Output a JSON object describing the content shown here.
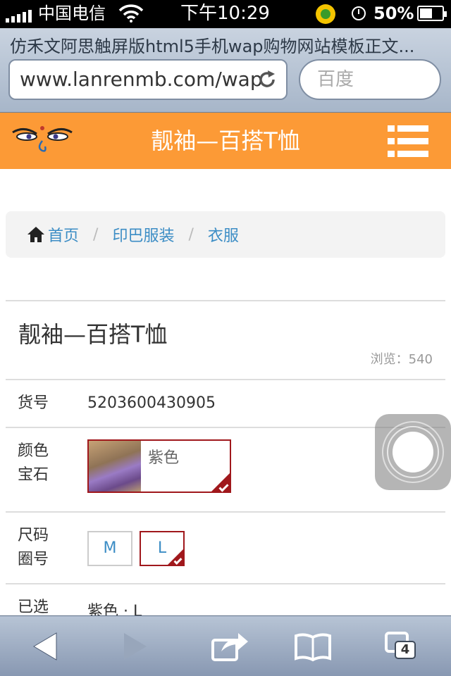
{
  "status_bar": {
    "carrier": "中国电信",
    "time": "下午10:29",
    "battery": "50%",
    "battery_level": 0.5
  },
  "browser": {
    "page_title": "仿禾文阿思触屏版html5手机wap购物网站模板正文...",
    "url": "www.lanrenmb.com/wap",
    "search_placeholder": "百度",
    "tab_count": "4"
  },
  "header": {
    "title": "靓袖—百搭T恤",
    "logo_icon": "buddha-eyes-logo",
    "menu_icon": "list-menu-icon",
    "background": "#fc9a36"
  },
  "breadcrumb": {
    "items": [
      "首页",
      "印巴服装",
      "衣服"
    ]
  },
  "product": {
    "name": "靓袖—百搭T恤",
    "views": "浏览：540",
    "sku_label": "货号",
    "sku": "5203600430905",
    "color_label_1": "颜色",
    "color_label_2": "宝石",
    "color_value": "紫色",
    "size_label_1": "尺码",
    "size_label_2": "圈号",
    "sizes": [
      "M",
      "L"
    ],
    "selected_size": "L",
    "selected_label": "已选",
    "selected_value": "紫色 · L",
    "accent_color": "#a0181c"
  }
}
